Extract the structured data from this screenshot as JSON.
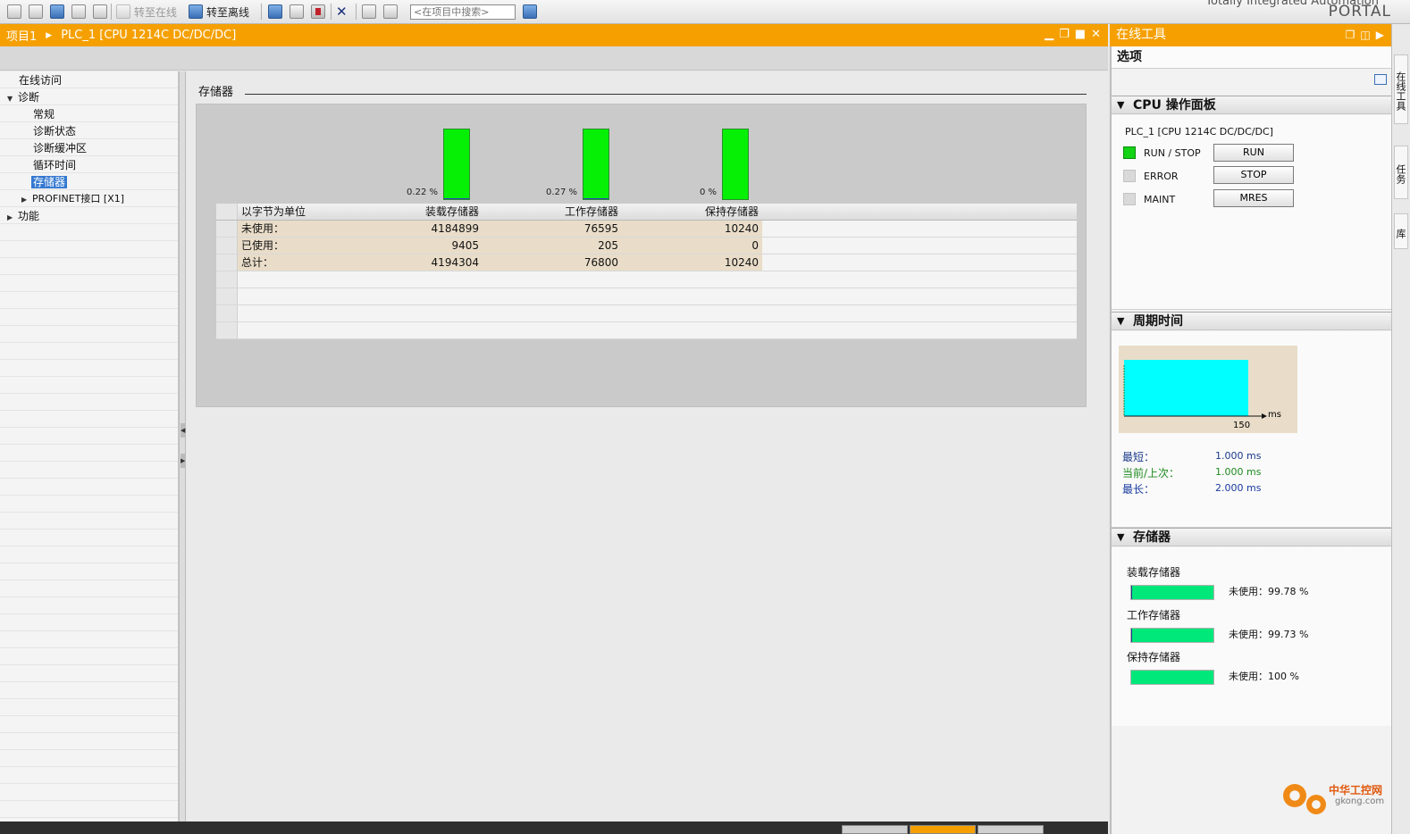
{
  "toolbar": {
    "go_online": "转至在线",
    "go_offline": "转至离线",
    "search_placeholder": "<在项目中搜索>"
  },
  "brand": {
    "line": "Totally Integrated Automation",
    "portal": "PORTAL"
  },
  "main": {
    "breadcrumb": [
      "项目1",
      "PLC_1 [CPU 1214C DC/DC/DC]"
    ]
  },
  "tree": {
    "online_access": "在线访问",
    "diagnostics": "诊断",
    "general": "常规",
    "diag_status": "诊断状态",
    "diag_buffer": "诊断缓冲区",
    "cycle_time": "循环时间",
    "memory": "存储器",
    "profinet": "PROFINET接口 [X1]",
    "functions": "功能"
  },
  "memory": {
    "section_title": "存储器",
    "bars": [
      {
        "pct_label": "0.22 %",
        "used_fraction": 0.0022
      },
      {
        "pct_label": "0.27 %",
        "used_fraction": 0.0027
      },
      {
        "pct_label": "0 %",
        "used_fraction": 0
      }
    ],
    "columns": [
      "以字节为单位",
      "装载存储器",
      "工作存储器",
      "保持存储器"
    ],
    "rows": [
      {
        "label": "未使用：",
        "load": "4184899",
        "work": "76595",
        "retain": "10240"
      },
      {
        "label": "已使用：",
        "load": "9405",
        "work": "205",
        "retain": "0"
      },
      {
        "label": "总计：",
        "load": "4194304",
        "work": "76800",
        "retain": "10240"
      }
    ]
  },
  "right_panel": {
    "title": "在线工具",
    "options": "选项",
    "cpu_panel": {
      "title": "CPU 操作面板",
      "device": "PLC_1 [CPU 1214C DC/DC/DC]",
      "run_stop": "RUN / STOP",
      "error": "ERROR",
      "maint": "MAINT",
      "run_btn": "RUN",
      "stop_btn": "STOP",
      "mres_btn": "MRES"
    },
    "cycle_time": {
      "title": "周期时间",
      "axis_unit": "ms",
      "axis_tick": "150",
      "min_label": "最短：",
      "min_value": "1.000 ms",
      "current_label": "当前/上次：",
      "current_value": "1.000 ms",
      "max_label": "最长：",
      "max_value": "2.000 ms"
    },
    "memory": {
      "title": "存储器",
      "items": [
        {
          "label": "装载存储器",
          "free": "未使用：99.78 %",
          "free_fraction": 0.9978
        },
        {
          "label": "工作存储器",
          "free": "未使用：99.73 %",
          "free_fraction": 0.9973
        },
        {
          "label": "保持存储器",
          "free": "未使用：100 %",
          "free_fraction": 1.0
        }
      ]
    }
  },
  "side_tabs": [
    "在线工具",
    "任务",
    "库"
  ],
  "watermark": {
    "name": "中华工控网",
    "url": "gkong.com"
  },
  "colors": {
    "title_bar": "#f5a000",
    "bar_green": "#05f005",
    "cycle_cyan": "#00ffff",
    "mem_green": "#00e87a"
  }
}
